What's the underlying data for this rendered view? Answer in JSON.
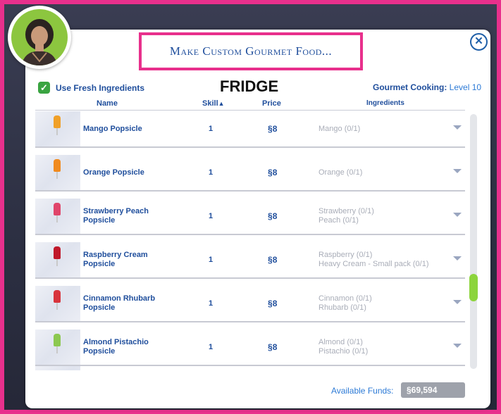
{
  "dialog": {
    "title": "Make Custom Gourmet Food...",
    "close_label": "✕"
  },
  "options": {
    "fresh_ingredients_label": "Use Fresh Ingredients",
    "fresh_ingredients_checked": true
  },
  "overlay_label": "FRIDGE",
  "skill_info": {
    "label": "Gourmet Cooking:",
    "level": "Level 10"
  },
  "table": {
    "headers": {
      "name": "Name",
      "skill": "Skill",
      "price": "Price",
      "ingredients": "Ingredients"
    },
    "rows": [
      {
        "name": "Mango Popsicle",
        "skill": "1",
        "price": "8",
        "ingredients": [
          "Mango (0/1)",
          ""
        ],
        "color": "#f0a028"
      },
      {
        "name": "Orange Popsicle",
        "skill": "1",
        "price": "8",
        "ingredients": [
          "Orange (0/1)",
          ""
        ],
        "color": "#f08a1e"
      },
      {
        "name": "Strawberry Peach Popsicle",
        "skill": "1",
        "price": "8",
        "ingredients": [
          "Strawberry (0/1)",
          "Peach (0/1)"
        ],
        "color": "#e0456a"
      },
      {
        "name": "Raspberry Cream Popsicle",
        "skill": "1",
        "price": "8",
        "ingredients": [
          "Raspberry (0/1)",
          "Heavy Cream - Small pack (0/1)"
        ],
        "color": "#c0182a"
      },
      {
        "name": "Cinnamon Rhubarb Popsicle",
        "skill": "1",
        "price": "8",
        "ingredients": [
          "Cinnamon (0/1)",
          "Rhubarb (0/1)"
        ],
        "color": "#d8343c"
      },
      {
        "name": "Almond Pistachio Popsicle",
        "skill": "1",
        "price": "8",
        "ingredients": [
          "Almond (0/1)",
          "Pistachio (0/1)"
        ],
        "color": "#8cc850"
      }
    ]
  },
  "currency_symbol": "§",
  "funds": {
    "label": "Available Funds:",
    "value": "§69,594"
  },
  "colors": {
    "accent_blue": "#1f4e9c",
    "highlight_pink": "#e8308c",
    "check_green": "#3aa441",
    "scroll_green": "#8cd43c"
  }
}
